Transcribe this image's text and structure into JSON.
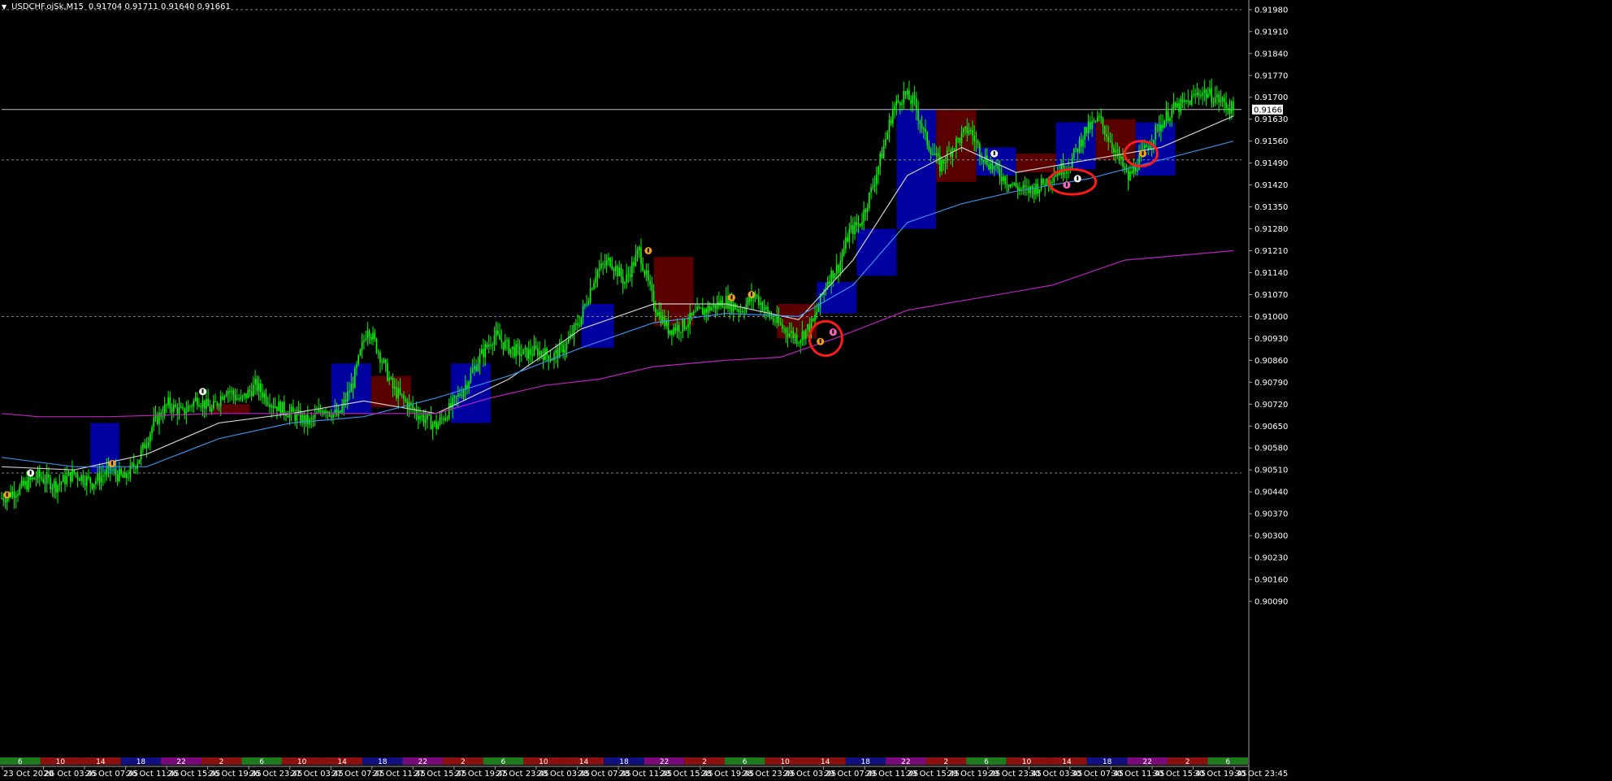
{
  "window": {
    "symbol_label": "USDCHF.ojSk,M15",
    "ohlc_label": "0.91704 0.91711 0.91640 0.91661"
  },
  "colors": {
    "background": "#000000",
    "bull_candle": "#00ff00",
    "box_bull": "#0000a0",
    "box_bear": "#5a0000",
    "ma_fast": "#cfcfcf",
    "ma_blue": "#3a8ee6",
    "ma_magenta": "#c020c0",
    "highlight_circle": "#ff1a1a",
    "current_price_line": "#c0c0c0"
  },
  "chart_data": {
    "type": "candlestick",
    "symbol": "USDCHF.ojSk",
    "timeframe": "M15",
    "ohlc_last": {
      "open": 0.91704,
      "high": 0.91711,
      "low": 0.9164,
      "close": 0.91661
    },
    "current_price": "0.91661",
    "ylim": [
      0.9009,
      0.9199
    ],
    "y_ticks": [
      "0.91980",
      "0.91910",
      "0.91840",
      "0.91770",
      "0.91700",
      "0.91630",
      "0.91560",
      "0.91490",
      "0.91420",
      "0.91350",
      "0.91280",
      "0.91210",
      "0.91140",
      "0.91070",
      "0.91000",
      "0.90930",
      "0.90860",
      "0.90790",
      "0.90720",
      "0.90650",
      "0.90580",
      "0.90510",
      "0.90440",
      "0.90370",
      "0.90300",
      "0.90230",
      "0.90160",
      "0.90090"
    ],
    "x_ticks": [
      "23 Oct 2020",
      "26 Oct 03:45",
      "26 Oct 07:45",
      "26 Oct 11:45",
      "26 Oct 15:45",
      "26 Oct 19:45",
      "26 Oct 23:45",
      "27 Oct 03:45",
      "27 Oct 07:45",
      "27 Oct 11:45",
      "27 Oct 15:45",
      "27 Oct 19:45",
      "27 Oct 23:45",
      "28 Oct 03:45",
      "28 Oct 07:45",
      "28 Oct 11:45",
      "28 Oct 15:45",
      "28 Oct 19:45",
      "28 Oct 23:45",
      "29 Oct 03:45",
      "29 Oct 07:45",
      "29 Oct 11:45",
      "29 Oct 15:45",
      "29 Oct 19:45",
      "29 Oct 23:45",
      "30 Oct 03:45",
      "30 Oct 07:45",
      "30 Oct 11:45",
      "30 Oct 15:45",
      "30 Oct 19:45",
      "30 Oct 23:45"
    ],
    "horizontal_levels": [
      0.9198,
      0.915,
      0.91,
      0.905
    ],
    "price_path": [
      [
        0,
        0.9042
      ],
      [
        10,
        0.9045
      ],
      [
        20,
        0.9049
      ],
      [
        30,
        0.9046
      ],
      [
        40,
        0.905
      ],
      [
        50,
        0.9047
      ],
      [
        60,
        0.9051
      ],
      [
        68,
        0.9048
      ],
      [
        76,
        0.9055
      ],
      [
        84,
        0.9066
      ],
      [
        92,
        0.9072
      ],
      [
        100,
        0.9069
      ],
      [
        108,
        0.9074
      ],
      [
        116,
        0.907
      ],
      [
        124,
        0.9077
      ],
      [
        132,
        0.9073
      ],
      [
        140,
        0.9078
      ],
      [
        150,
        0.9072
      ],
      [
        160,
        0.9069
      ],
      [
        170,
        0.9066
      ],
      [
        178,
        0.9071
      ],
      [
        186,
        0.9068
      ],
      [
        194,
        0.9079
      ],
      [
        202,
        0.9097
      ],
      [
        208,
        0.9089
      ],
      [
        216,
        0.9077
      ],
      [
        224,
        0.9072
      ],
      [
        232,
        0.9068
      ],
      [
        240,
        0.9065
      ],
      [
        248,
        0.9071
      ],
      [
        256,
        0.9078
      ],
      [
        264,
        0.9087
      ],
      [
        272,
        0.9094
      ],
      [
        280,
        0.909
      ],
      [
        288,
        0.9088
      ],
      [
        296,
        0.9089
      ],
      [
        304,
        0.9087
      ],
      [
        312,
        0.9091
      ],
      [
        320,
        0.91
      ],
      [
        328,
        0.9114
      ],
      [
        336,
        0.9118
      ],
      [
        344,
        0.9111
      ],
      [
        352,
        0.9121
      ],
      [
        360,
        0.9104
      ],
      [
        368,
        0.9096
      ],
      [
        376,
        0.9097
      ],
      [
        384,
        0.9101
      ],
      [
        392,
        0.9103
      ],
      [
        400,
        0.9105
      ],
      [
        408,
        0.9102
      ],
      [
        416,
        0.9107
      ],
      [
        424,
        0.91
      ],
      [
        432,
        0.9096
      ],
      [
        440,
        0.9093
      ],
      [
        448,
        0.9098
      ],
      [
        456,
        0.9112
      ],
      [
        462,
        0.9116
      ],
      [
        468,
        0.9127
      ],
      [
        474,
        0.913
      ],
      [
        480,
        0.914
      ],
      [
        486,
        0.9152
      ],
      [
        492,
        0.9166
      ],
      [
        498,
        0.9171
      ],
      [
        504,
        0.9168
      ],
      [
        510,
        0.9157
      ],
      [
        518,
        0.9148
      ],
      [
        526,
        0.9155
      ],
      [
        534,
        0.916
      ],
      [
        542,
        0.9151
      ],
      [
        550,
        0.9146
      ],
      [
        558,
        0.9142
      ],
      [
        566,
        0.914
      ],
      [
        574,
        0.9142
      ],
      [
        582,
        0.9146
      ],
      [
        590,
        0.9149
      ],
      [
        598,
        0.9159
      ],
      [
        606,
        0.9163
      ],
      [
        614,
        0.9154
      ],
      [
        622,
        0.9144
      ],
      [
        630,
        0.9152
      ],
      [
        638,
        0.916
      ],
      [
        646,
        0.9166
      ],
      [
        654,
        0.9168
      ],
      [
        662,
        0.9172
      ],
      [
        670,
        0.917
      ],
      [
        680,
        0.9166
      ]
    ],
    "moving_averages": [
      {
        "color": "#cfcfcf",
        "points": [
          [
            0,
            0.9052
          ],
          [
            40,
            0.9051
          ],
          [
            80,
            0.9056
          ],
          [
            120,
            0.9066
          ],
          [
            160,
            0.9069
          ],
          [
            200,
            0.9073
          ],
          [
            240,
            0.9069
          ],
          [
            280,
            0.908
          ],
          [
            320,
            0.9096
          ],
          [
            360,
            0.9104
          ],
          [
            400,
            0.9104
          ],
          [
            440,
            0.9099
          ],
          [
            470,
            0.9118
          ],
          [
            500,
            0.9145
          ],
          [
            530,
            0.9154
          ],
          [
            560,
            0.9146
          ],
          [
            600,
            0.915
          ],
          [
            640,
            0.9154
          ],
          [
            680,
            0.9164
          ]
        ]
      },
      {
        "color": "#3a8ee6",
        "points": [
          [
            0,
            0.9055
          ],
          [
            40,
            0.9052
          ],
          [
            80,
            0.9052
          ],
          [
            120,
            0.9061
          ],
          [
            160,
            0.9066
          ],
          [
            200,
            0.9068
          ],
          [
            240,
            0.9074
          ],
          [
            280,
            0.9081
          ],
          [
            320,
            0.909
          ],
          [
            360,
            0.9098
          ],
          [
            400,
            0.9101
          ],
          [
            440,
            0.91
          ],
          [
            470,
            0.911
          ],
          [
            500,
            0.913
          ],
          [
            530,
            0.9136
          ],
          [
            560,
            0.914
          ],
          [
            600,
            0.9144
          ],
          [
            640,
            0.915
          ],
          [
            680,
            0.9156
          ]
        ]
      },
      {
        "color": "#c020c0",
        "points": [
          [
            0,
            0.9069
          ],
          [
            20,
            0.9068
          ],
          [
            60,
            0.9068
          ],
          [
            120,
            0.9069
          ],
          [
            160,
            0.9069
          ],
          [
            200,
            0.9069
          ],
          [
            240,
            0.9069
          ],
          [
            270,
            0.9074
          ],
          [
            300,
            0.9078
          ],
          [
            330,
            0.908
          ],
          [
            360,
            0.9084
          ],
          [
            400,
            0.9086
          ],
          [
            430,
            0.9087
          ],
          [
            460,
            0.9093
          ],
          [
            500,
            0.9102
          ],
          [
            540,
            0.9106
          ],
          [
            580,
            0.911
          ],
          [
            620,
            0.9118
          ],
          [
            660,
            0.912
          ],
          [
            680,
            0.9121
          ]
        ]
      }
    ],
    "session_boxes": [
      {
        "x0": 49,
        "x1": 65,
        "low": 0.905,
        "high": 0.9066,
        "color": "bull"
      },
      {
        "x0": 115,
        "x1": 137,
        "low": 0.9069,
        "high": 0.9072,
        "color": "bear"
      },
      {
        "x0": 182,
        "x1": 204,
        "low": 0.9069,
        "high": 0.9085,
        "color": "bull"
      },
      {
        "x0": 204,
        "x1": 226,
        "low": 0.9071,
        "high": 0.9081,
        "color": "bear"
      },
      {
        "x0": 248,
        "x1": 270,
        "low": 0.9066,
        "high": 0.9085,
        "color": "bull"
      },
      {
        "x0": 320,
        "x1": 338,
        "low": 0.909,
        "high": 0.9104,
        "color": "bull"
      },
      {
        "x0": 360,
        "x1": 382,
        "low": 0.9097,
        "high": 0.9119,
        "color": "bear"
      },
      {
        "x0": 428,
        "x1": 450,
        "low": 0.9093,
        "high": 0.9104,
        "color": "bear"
      },
      {
        "x0": 450,
        "x1": 472,
        "low": 0.9101,
        "high": 0.9111,
        "color": "bull"
      },
      {
        "x0": 472,
        "x1": 494,
        "low": 0.9113,
        "high": 0.9128,
        "color": "bull"
      },
      {
        "x0": 494,
        "x1": 516,
        "low": 0.9128,
        "high": 0.9166,
        "color": "bull"
      },
      {
        "x0": 516,
        "x1": 538,
        "low": 0.9143,
        "high": 0.9166,
        "color": "bear"
      },
      {
        "x0": 538,
        "x1": 560,
        "low": 0.9145,
        "high": 0.9154,
        "color": "bull"
      },
      {
        "x0": 560,
        "x1": 582,
        "low": 0.9146,
        "high": 0.9152,
        "color": "bear"
      },
      {
        "x0": 582,
        "x1": 604,
        "low": 0.9147,
        "high": 0.9162,
        "color": "bull"
      },
      {
        "x0": 604,
        "x1": 626,
        "low": 0.915,
        "high": 0.9163,
        "color": "bear"
      },
      {
        "x0": 626,
        "x1": 648,
        "low": 0.9145,
        "high": 0.9162,
        "color": "bull"
      }
    ],
    "markers": [
      {
        "x": 3,
        "p": 0.9043,
        "color": "#f0a020"
      },
      {
        "x": 16,
        "p": 0.905,
        "color": "#ffffff"
      },
      {
        "x": 61,
        "p": 0.9053,
        "color": "#f0a020"
      },
      {
        "x": 111,
        "p": 0.9076,
        "color": "#ffffff"
      },
      {
        "x": 357,
        "p": 0.9121,
        "color": "#f0a020"
      },
      {
        "x": 403,
        "p": 0.9106,
        "color": "#f0a020"
      },
      {
        "x": 414,
        "p": 0.9107,
        "color": "#f0a020"
      },
      {
        "x": 452,
        "p": 0.9092,
        "color": "#f0a020"
      },
      {
        "x": 459,
        "p": 0.9095,
        "color": "#ff60c0"
      },
      {
        "x": 548,
        "p": 0.9152,
        "color": "#ffffff"
      },
      {
        "x": 588,
        "p": 0.9142,
        "color": "#ff60c0"
      },
      {
        "x": 594,
        "p": 0.9144,
        "color": "#ffffff"
      },
      {
        "x": 630,
        "p": 0.9152,
        "color": "#f0a020"
      }
    ],
    "highlight_circles": [
      {
        "x": 455,
        "p": 0.9093,
        "rx_units": 9,
        "ry_price": 0.00055
      },
      {
        "x": 591,
        "p": 0.9143,
        "rx_units": 13,
        "ry_price": 0.0004
      },
      {
        "x": 629,
        "p": 0.9152,
        "rx_units": 9,
        "ry_price": 0.0004
      }
    ],
    "hour_strip": [
      {
        "label": "6",
        "color": "#1d7a1d"
      },
      {
        "label": "10",
        "color": "#8a1010"
      },
      {
        "label": "14",
        "color": "#8a1010"
      },
      {
        "label": "18",
        "color": "#101080"
      },
      {
        "label": "22",
        "color": "#7a0a7a"
      },
      {
        "label": "2",
        "color": "#8a1010"
      },
      {
        "label": "6",
        "color": "#1d7a1d"
      },
      {
        "label": "10",
        "color": "#8a1010"
      },
      {
        "label": "14",
        "color": "#8a1010"
      },
      {
        "label": "18",
        "color": "#101080"
      },
      {
        "label": "22",
        "color": "#7a0a7a"
      },
      {
        "label": "2",
        "color": "#8a1010"
      },
      {
        "label": "6",
        "color": "#1d7a1d"
      },
      {
        "label": "10",
        "color": "#8a1010"
      },
      {
        "label": "14",
        "color": "#8a1010"
      },
      {
        "label": "18",
        "color": "#101080"
      },
      {
        "label": "22",
        "color": "#7a0a7a"
      },
      {
        "label": "2",
        "color": "#8a1010"
      },
      {
        "label": "6",
        "color": "#1d7a1d"
      },
      {
        "label": "10",
        "color": "#8a1010"
      },
      {
        "label": "14",
        "color": "#8a1010"
      },
      {
        "label": "18",
        "color": "#101080"
      },
      {
        "label": "22",
        "color": "#7a0a7a"
      },
      {
        "label": "2",
        "color": "#8a1010"
      },
      {
        "label": "6",
        "color": "#1d7a1d"
      },
      {
        "label": "10",
        "color": "#8a1010"
      },
      {
        "label": "14",
        "color": "#8a1010"
      },
      {
        "label": "18",
        "color": "#101080"
      },
      {
        "label": "22",
        "color": "#7a0a7a"
      },
      {
        "label": "2",
        "color": "#8a1010"
      },
      {
        "label": "6",
        "color": "#1d7a1d"
      }
    ]
  }
}
